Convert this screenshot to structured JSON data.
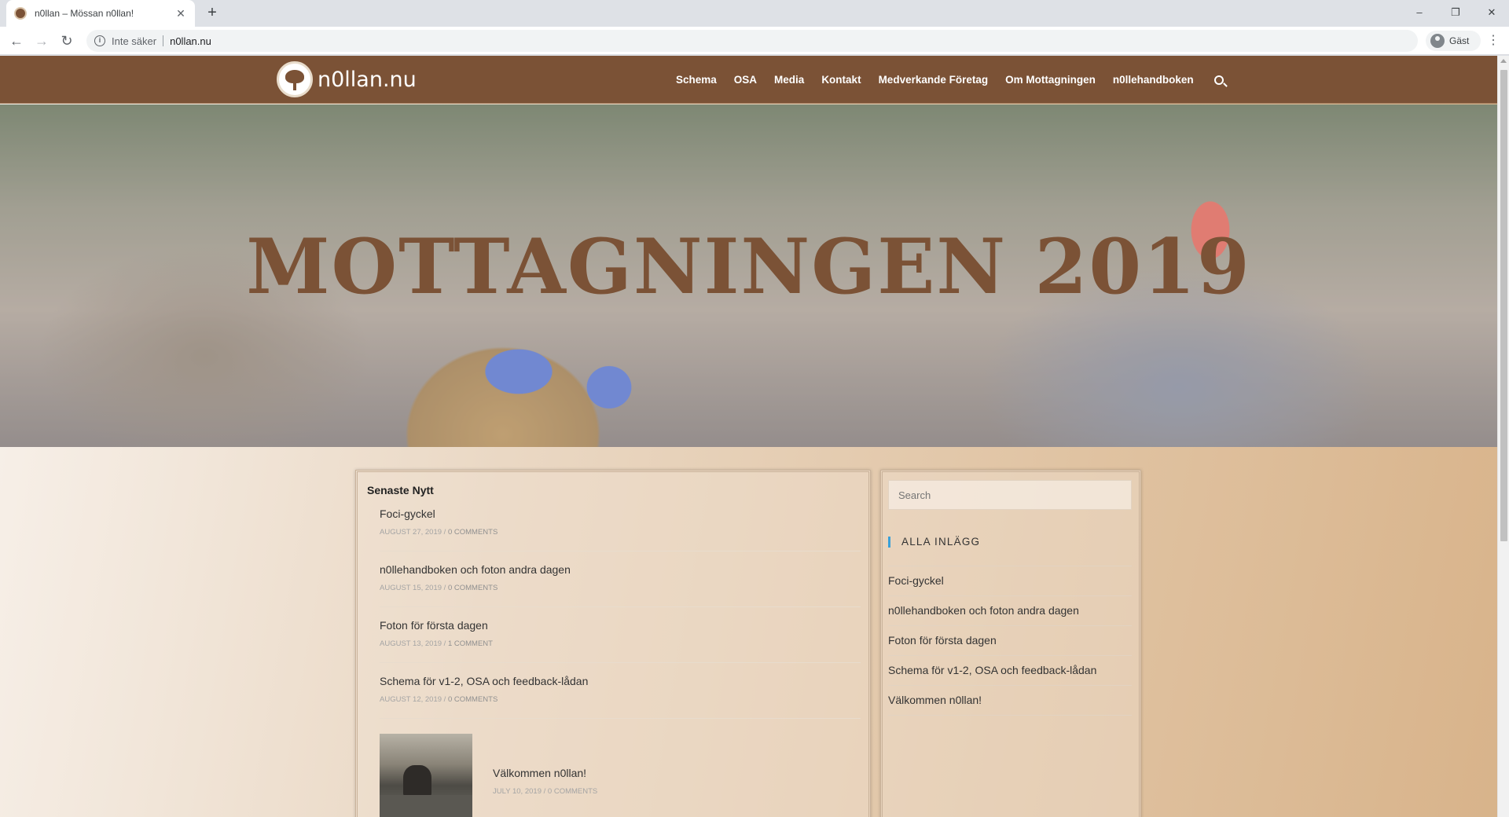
{
  "browser": {
    "tab_title": "n0llan – Mössan n0llan!",
    "new_tab_label": "+",
    "security_label": "Inte säker",
    "url": "n0llan.nu",
    "profile_label": "Gäst",
    "window_controls": {
      "minimize": "–",
      "restore": "❐",
      "close": "✕"
    },
    "nav": {
      "back": "←",
      "forward": "→",
      "reload": "↻"
    }
  },
  "site": {
    "logo_text": "n0llan.nu",
    "nav": [
      "Schema",
      "OSA",
      "Media",
      "Kontakt",
      "Medverkande Företag",
      "Om Mottagningen",
      "n0llehandboken"
    ],
    "hero_title": "MOTTAGNINGEN 2019"
  },
  "latest": {
    "heading": "Senaste Nytt",
    "posts": [
      {
        "title": "Foci-gyckel",
        "date": "AUGUST 27, 2019 /",
        "comments": "0 COMMENTS"
      },
      {
        "title": "n0llehandboken och foton andra dagen",
        "date": "AUGUST 15, 2019 /",
        "comments": "0 COMMENTS"
      },
      {
        "title": "Foton för första dagen",
        "date": "AUGUST 13, 2019 /",
        "comments": "1 COMMENT"
      },
      {
        "title": "Schema för v1-2, OSA och feedback-lådan",
        "date": "AUGUST 12, 2019 /",
        "comments": "0 COMMENTS"
      }
    ],
    "featured": {
      "title": "Välkommen n0llan!",
      "date": "JULY 10, 2019 /",
      "comments": "0 COMMENTS"
    }
  },
  "sidebar": {
    "search_placeholder": "Search",
    "widget_title": "ALLA INLÄGG",
    "items": [
      "Foci-gyckel",
      "n0llehandboken och foton andra dagen",
      "Foton för första dagen",
      "Schema för v1-2, OSA och feedback-lådan",
      "Välkommen n0llan!"
    ]
  },
  "colors": {
    "header_brown": "#7b5236",
    "accent_blue": "#3aa0d8"
  }
}
